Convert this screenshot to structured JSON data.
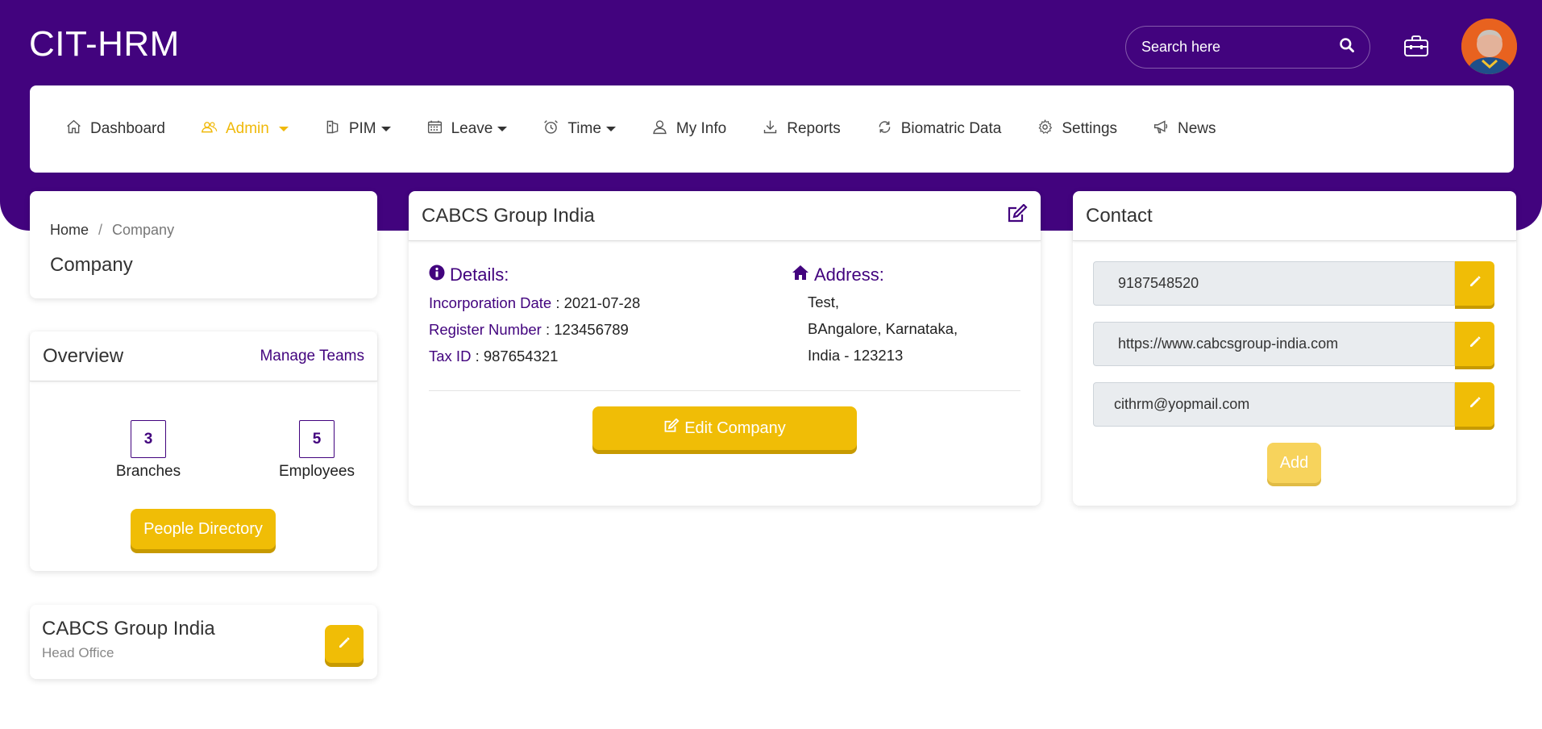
{
  "app": {
    "brand": "CIT-HRM"
  },
  "header": {
    "search_placeholder": "Search here"
  },
  "nav": {
    "items": [
      {
        "label": "Dashboard",
        "icon": "home-icon"
      },
      {
        "label": "Admin",
        "icon": "users-icon",
        "active": true,
        "dropdown": true
      },
      {
        "label": "PIM",
        "icon": "id-card-icon",
        "dropdown": true
      },
      {
        "label": "Leave",
        "icon": "calendar-icon",
        "dropdown": true
      },
      {
        "label": "Time",
        "icon": "alarm-clock-icon",
        "dropdown": true
      },
      {
        "label": "My Info",
        "icon": "user-icon"
      },
      {
        "label": "Reports",
        "icon": "download-icon"
      },
      {
        "label": "Biomatric Data",
        "icon": "refresh-icon"
      },
      {
        "label": "Settings",
        "icon": "gear-icon"
      },
      {
        "label": "News",
        "icon": "megaphone-icon"
      }
    ]
  },
  "breadcrumb": {
    "home": "Home",
    "separator": "/",
    "current": "Company"
  },
  "page_title": "Company",
  "overview": {
    "title": "Overview",
    "manage_link": "Manage Teams",
    "branches_count": "3",
    "branches_label": "Branches",
    "employees_count": "5",
    "employees_label": "Employees",
    "directory_button": "People Directory"
  },
  "office": {
    "name": "CABCS Group India",
    "type": "Head Office"
  },
  "company": {
    "name": "CABCS Group India",
    "details_title": "Details:",
    "incorporation_label": "Incorporation Date",
    "incorporation_value": " : 2021-07-28",
    "register_label": "Register Number",
    "register_value": " : 123456789",
    "tax_label": "Tax ID",
    "tax_value": " : 987654321",
    "address_title": "Address:",
    "address_line1": "Test,",
    "address_line2": "BAngalore, Karnataka,",
    "address_line3": "India - 123213",
    "edit_button": "Edit Company"
  },
  "contact": {
    "title": "Contact",
    "phone": "9187548520",
    "website": "https://www.cabcsgroup-india.com",
    "email": "cithrm@yopmail.com",
    "add_button": "Add"
  },
  "colors": {
    "primary": "#42037e",
    "accent": "#f0bd06",
    "active_nav": "#f0b90a"
  }
}
